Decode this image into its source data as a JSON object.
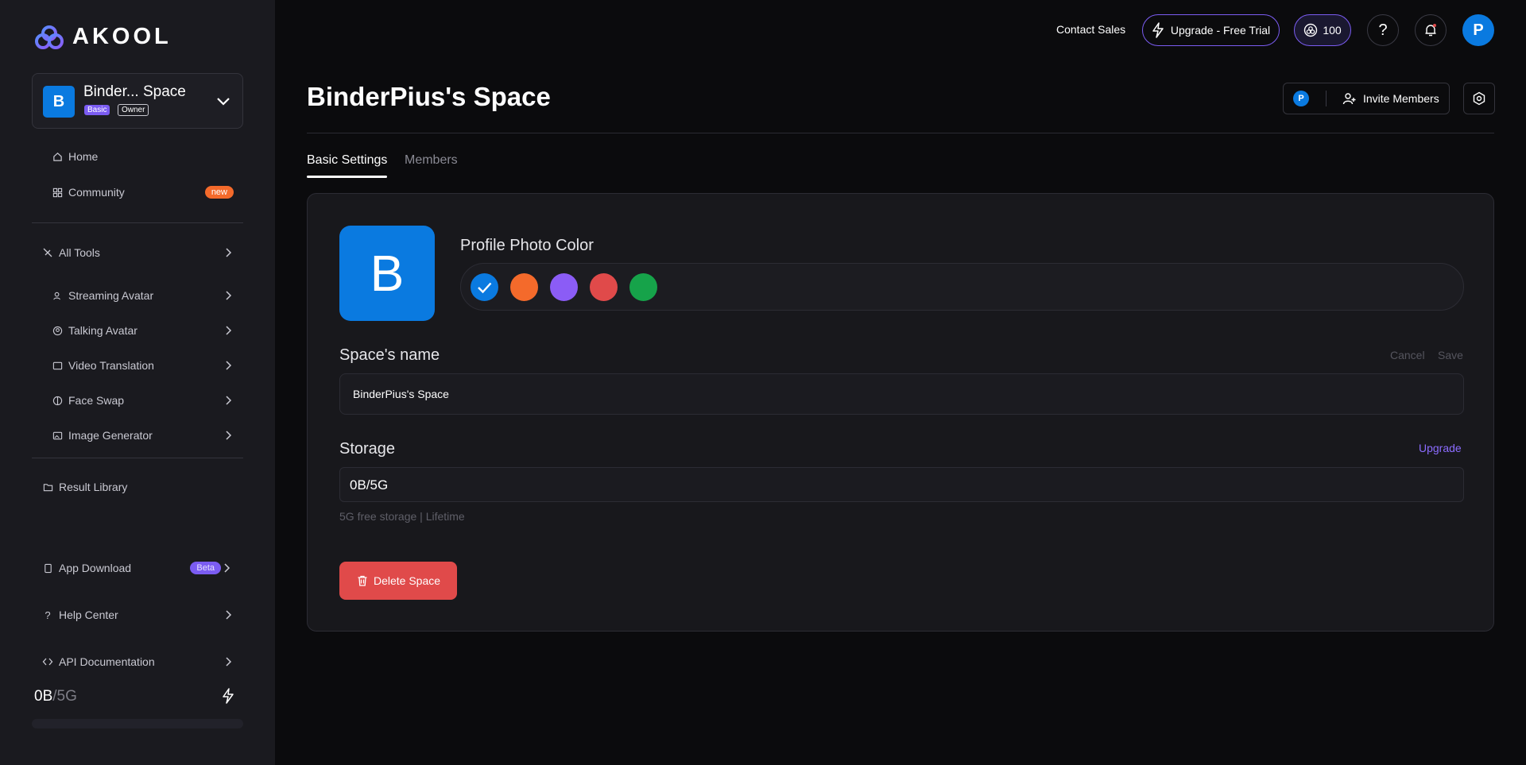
{
  "brand": {
    "name": "AKOOL"
  },
  "space": {
    "name": "Binder... Space",
    "avatar_letter": "B",
    "plan_badge": "Basic",
    "role_badge": "Owner"
  },
  "sidebar": {
    "home": "Home",
    "community": "Community",
    "community_badge": "new",
    "all_tools": "All Tools",
    "tools": [
      {
        "label": "Streaming Avatar",
        "icon": "streaming-avatar-icon"
      },
      {
        "label": "Talking Avatar",
        "icon": "talking-avatar-icon"
      },
      {
        "label": "Video Translation",
        "icon": "video-translation-icon"
      },
      {
        "label": "Face Swap",
        "icon": "face-swap-icon"
      },
      {
        "label": "Image Generator",
        "icon": "image-generator-icon"
      }
    ],
    "result_library": "Result Library",
    "app_download": "App Download",
    "app_download_badge": "Beta",
    "help_center": "Help Center",
    "api_docs": "API Documentation",
    "storage_used": "0B",
    "storage_sep": "/",
    "storage_total": "5G"
  },
  "topbar": {
    "contact_sales": "Contact Sales",
    "upgrade": "Upgrade - Free Trial",
    "credits": "100",
    "user_initial": "P"
  },
  "main": {
    "title": "BinderPius's Space",
    "member_initial": "P",
    "invite": "Invite Members",
    "tabs": [
      {
        "label": "Basic Settings",
        "active": true
      },
      {
        "label": "Members",
        "active": false
      }
    ],
    "avatar_letter": "B",
    "profile_photo_color_label": "Profile Photo Color",
    "colors": [
      "#0a7ae0",
      "#f46a2b",
      "#8b5cf6",
      "#e04a4a",
      "#16a34a"
    ],
    "selected_color": "#0a7ae0",
    "space_name_label": "Space's name",
    "cancel": "Cancel",
    "save": "Save",
    "space_name_value": "BinderPius's Space",
    "storage_label": "Storage",
    "upgrade_link": "Upgrade",
    "storage_value": "0B/5G",
    "storage_note": "5G free storage | Lifetime",
    "delete": "Delete Space"
  }
}
